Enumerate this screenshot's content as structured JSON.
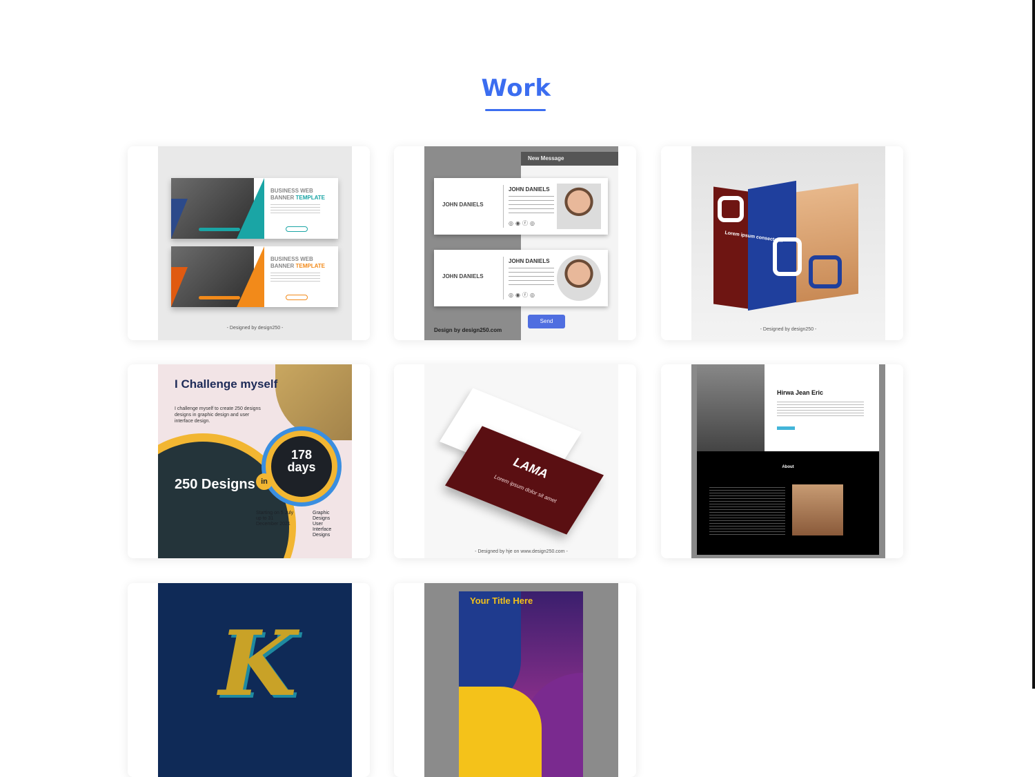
{
  "section": {
    "title": "Work"
  },
  "portfolio": {
    "items": [
      {
        "banner_top_title_1": "BUSINESS WEB",
        "banner_top_title_2": "BANNER",
        "banner_top_accent": "TEMPLATE",
        "banner_bottom_title_1": "BUSINESS WEB",
        "banner_bottom_title_2": "BANNER",
        "banner_bottom_accent": "TEMPLATE",
        "credit": "- Designed by design250 -"
      },
      {
        "panel_title": "New Message",
        "sig_name_left": "JOHN DANIELS",
        "sig_name_right": "JOHN DANIELS",
        "send_label": "Send",
        "footer": "Design by design250.com"
      },
      {
        "lorem": "Lorem ipsum consectetur",
        "credit": "- Designed by design250 -"
      },
      {
        "headline": "I Challenge myself",
        "subtitle": "I challenge myself to create 250 designs designs in graphic design and user interface design.",
        "days": "178 days",
        "in": "in",
        "designs": "250 Designs",
        "starting": "Starting on 5 July up to 31 December 2021",
        "categories": "Graphic Designs User Interface Designs"
      },
      {
        "logo": "LAMA",
        "tagline": "Lorem ipsum dolor sit amet",
        "credit": "- Designed by hje on www.design250.com -"
      },
      {
        "name": "Hirwa Jean Eric",
        "about": "About"
      },
      {
        "letter": "K"
      },
      {
        "title": "Your Title Here"
      }
    ]
  },
  "colors": {
    "accent": "#3b6df0"
  }
}
